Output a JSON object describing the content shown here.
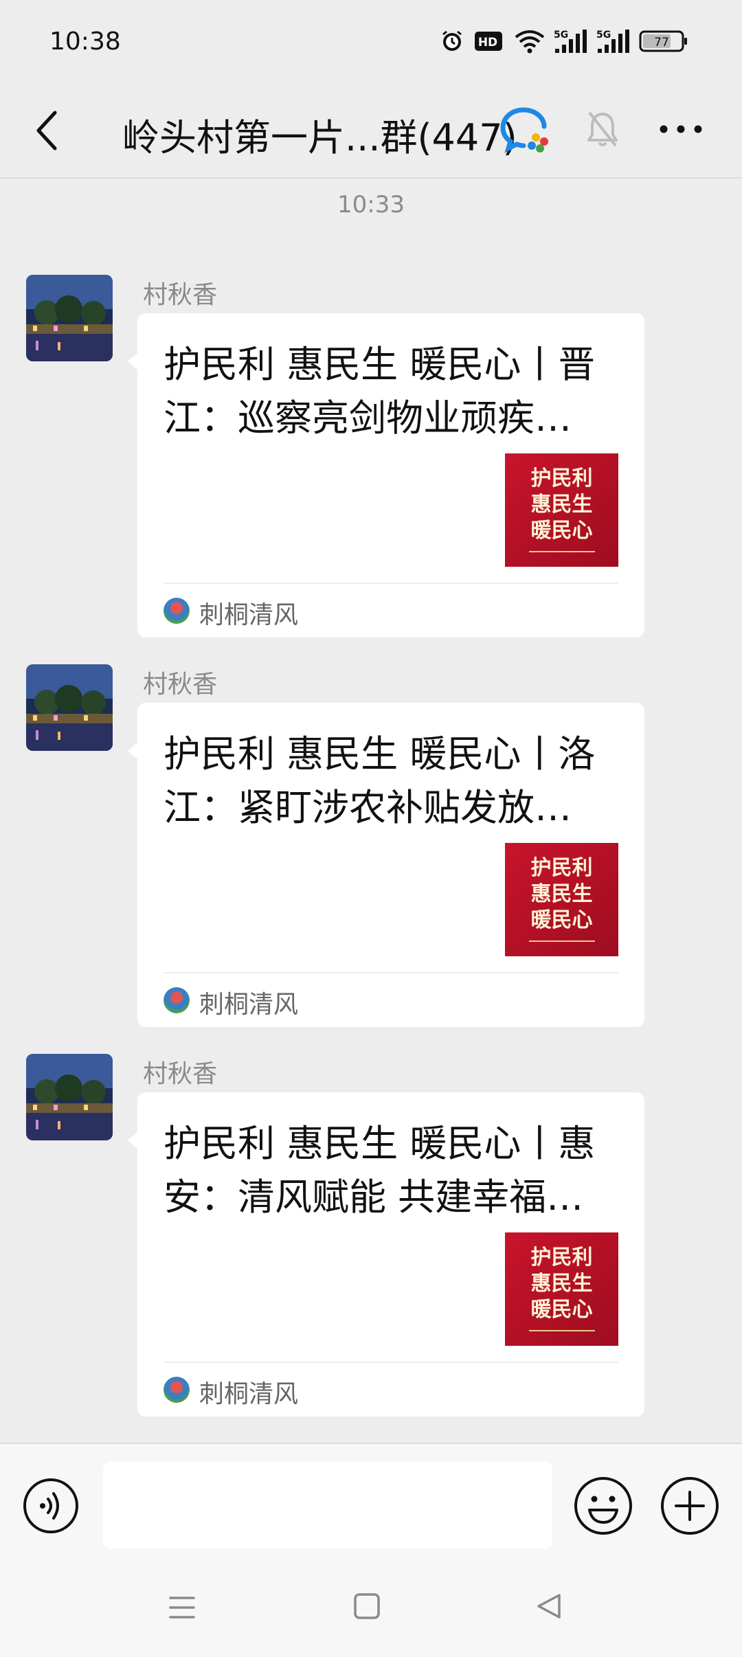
{
  "status_bar": {
    "time": "10:38",
    "battery": "77",
    "hd_label": "HD",
    "net1": "5G",
    "net2": "5G"
  },
  "header": {
    "title": "岭头村第一片...群(447)"
  },
  "timestamp": "10:33",
  "messages": [
    {
      "sender": "村秋香",
      "title": "护民利 惠民生 暖民心丨晋江：巡察亮剑物业顽疾 清…",
      "thumb_text": [
        "护民利",
        "惠民生",
        "暖民心"
      ],
      "source": "刺桐清风"
    },
    {
      "sender": "村秋香",
      "title": "护民利 惠民生 暖民心丨洛江：紧盯涉农补贴发放 纠…",
      "thumb_text": [
        "护民利",
        "惠民生",
        "暖民心"
      ],
      "source": "刺桐清风"
    },
    {
      "sender": "村秋香",
      "title": "护民利 惠民生 暖民心丨惠安：清风赋能 共建幸福小区",
      "thumb_text": [
        "护民利",
        "惠民生",
        "暖民心"
      ],
      "source": "刺桐清风"
    }
  ],
  "colors": {
    "background": "#ededed",
    "card": "#ffffff",
    "thumb_red": "#c8142c",
    "muted_text": "#8a8a8a"
  }
}
